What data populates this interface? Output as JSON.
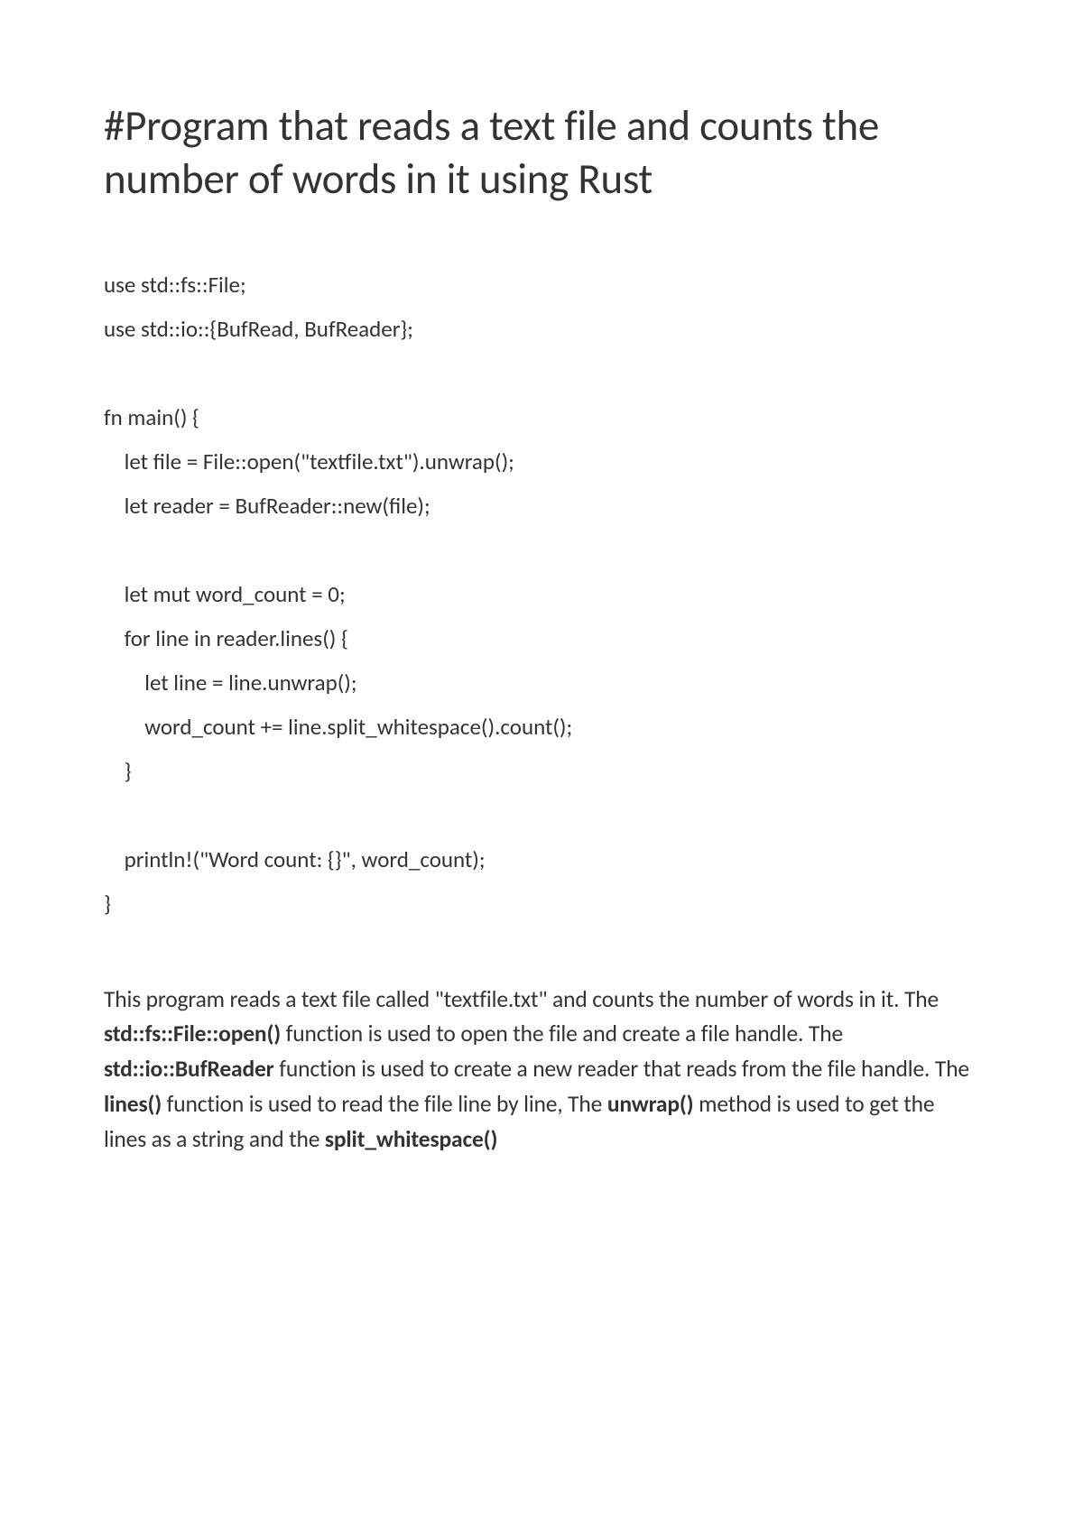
{
  "title": "#Program that reads a text file and counts the number of words in it using Rust",
  "code": {
    "line1": "use std::fs::File;",
    "line2": "use std::io::{BufRead, BufReader};",
    "line3": "fn main() {",
    "line4": "    let file = File::open(\"textfile.txt\").unwrap();",
    "line5": "    let reader = BufReader::new(file);",
    "line6": "    let mut word_count = 0;",
    "line7": "    for line in reader.lines() {",
    "line8": "        let line = line.unwrap();",
    "line9": "        word_count += line.split_whitespace().count();",
    "line10": "    }",
    "line11": "    println!(\"Word count: {}\", word_count);",
    "line12": "}"
  },
  "explanation": {
    "part1": "This program reads a text file called \"textfile.txt\" and counts the number of words in it. The ",
    "bold1": "std::fs::File::open()",
    "part2": " function is used to open the file and create a file handle. The ",
    "bold2": "std::io::BufReader",
    "part3": " function is used to create a new reader that reads from the file handle. The ",
    "bold3": "lines()",
    "part4": " function is used to read the file line by line, The ",
    "bold4": "unwrap()",
    "part5": " method is used to get the lines as a string and the ",
    "bold5": "split_whitespace()"
  }
}
